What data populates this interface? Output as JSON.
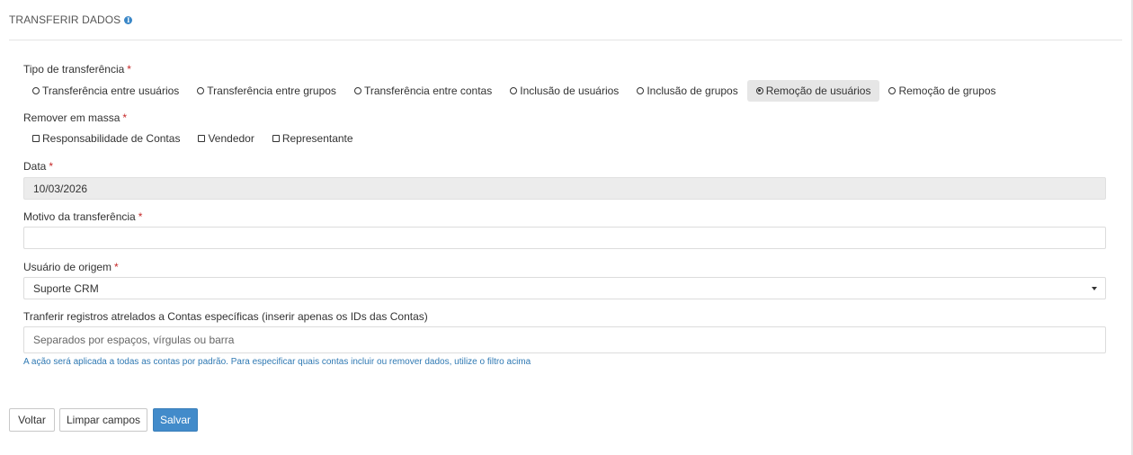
{
  "header": {
    "title": "TRANSFERIR DADOS",
    "info_icon": "info-icon"
  },
  "tipo": {
    "label": "Tipo de transferência",
    "required_mark": "*",
    "options": [
      {
        "label": "Transferência entre usuários",
        "selected": false
      },
      {
        "label": "Transferência entre grupos",
        "selected": false
      },
      {
        "label": "Transferência entre contas",
        "selected": false
      },
      {
        "label": "Inclusão de usuários",
        "selected": false
      },
      {
        "label": "Inclusão de grupos",
        "selected": false
      },
      {
        "label": "Remoção de usuários",
        "selected": true
      },
      {
        "label": "Remoção de grupos",
        "selected": false
      }
    ]
  },
  "remover": {
    "label": "Remover em massa",
    "required_mark": "*",
    "options": [
      {
        "label": "Responsabilidade de Contas",
        "checked": false
      },
      {
        "label": "Vendedor",
        "checked": false
      },
      {
        "label": "Representante",
        "checked": false
      }
    ]
  },
  "data": {
    "label": "Data",
    "required_mark": "*",
    "value": "10/03/2026"
  },
  "motivo": {
    "label": "Motivo da transferência",
    "required_mark": "*",
    "value": ""
  },
  "usuario": {
    "label": "Usuário de origem",
    "required_mark": "*",
    "value": "Suporte CRM"
  },
  "contas": {
    "label": "Tranferir registros atrelados a Contas específicas (inserir apenas os IDs das Contas)",
    "placeholder": "Separados por espaços, vírgulas ou barra",
    "hint": "A ação será aplicada a todas as contas por padrão. Para especificar quais contas incluir ou remover dados, utilize o filtro acima"
  },
  "buttons": {
    "back": "Voltar",
    "clear": "Limpar campos",
    "save": "Salvar"
  },
  "colors": {
    "primary": "#428bca",
    "required": "#c62828",
    "hint": "#2f79b3",
    "selected_bg": "#e6e6e6"
  }
}
